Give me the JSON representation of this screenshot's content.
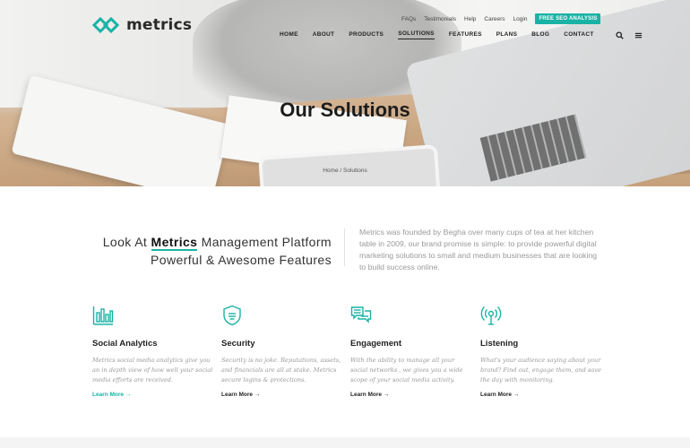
{
  "brand": {
    "name": "metrics",
    "accent": "#19b3a5"
  },
  "top_links": [
    "FAQs",
    "Testimonials",
    "Help",
    "Careers",
    "Login"
  ],
  "seo_button": "FREE SEO ANALYSIS",
  "nav": {
    "items": [
      "HOME",
      "ABOUT",
      "PRODUCTS",
      "SOLUTIONS",
      "FEATURES",
      "PLANS",
      "BLOG",
      "CONTACT"
    ],
    "active": "SOLUTIONS",
    "icons": [
      "search-icon",
      "menu-icon"
    ]
  },
  "hero": {
    "title": "Our Solutions",
    "breadcrumb": {
      "home": "Home",
      "separator": "/",
      "current": "Solutions"
    }
  },
  "intro": {
    "left_prefix": "Look At",
    "left_brand": "Metrics",
    "left_suffix": "Management Platform",
    "left_line2": "Powerful & Awesome Features",
    "right_text": "Metrics was founded by Begha over many cups of tea at her kitchen table in 2009, our brand promise is simple: to provide powerful digital marketing solutions to small and medium businesses that are looking to build success online."
  },
  "features": [
    {
      "icon": "bar-chart-icon",
      "title": "Social Analytics",
      "description": "Metrics social media analytics give you an in depth view of how well your social media efforts are received.",
      "link": "Learn More →",
      "link_color": "#19b3a5"
    },
    {
      "icon": "shield-icon",
      "title": "Security",
      "description": "Security is no joke. Reputations, assets, and financials are all at stake. Metrics secure logins & protections.",
      "link": "Learn More →",
      "link_color": "#222222"
    },
    {
      "icon": "chat-icon",
      "title": "Engagement",
      "description": "With the ability to manage all your social networks , we gives you a wide scope of your social media activity.",
      "link": "Learn More →",
      "link_color": "#222222"
    },
    {
      "icon": "broadcast-icon",
      "title": "Listening",
      "description": "What's your audience saying about your brand? Find out, engage them, and save the day with monitoring.",
      "link": "Learn More →",
      "link_color": "#222222"
    }
  ]
}
